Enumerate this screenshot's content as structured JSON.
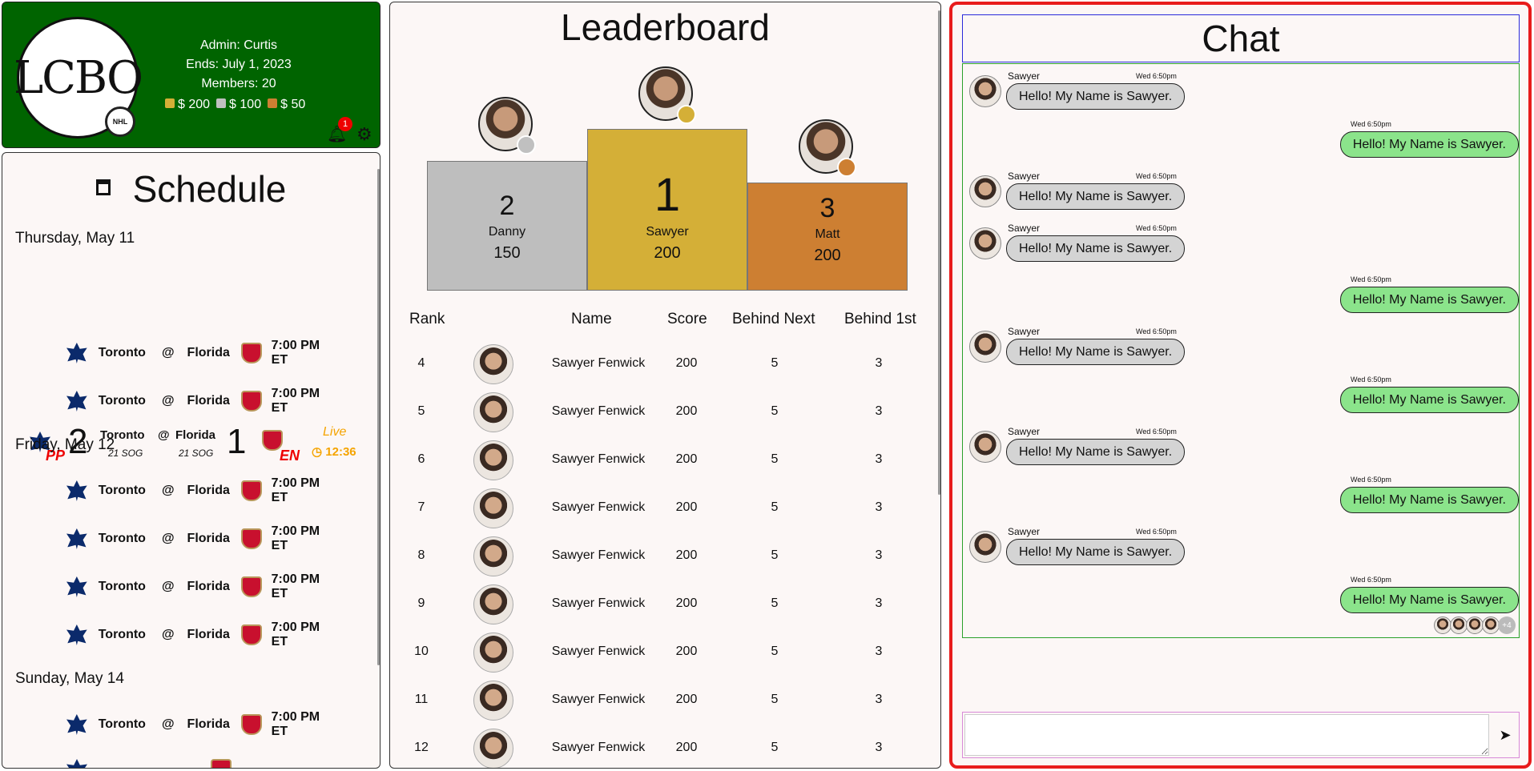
{
  "league": {
    "logo_text": "LCBO",
    "admin": "Admin: Curtis",
    "ends": "Ends: July 1, 2023",
    "members": "Members: 20",
    "prizes": [
      "$ 200",
      "$ 100",
      "$ 50"
    ],
    "notifications": "1",
    "colors": {
      "bg": "#006400",
      "gold": "#d4af37",
      "silver": "#c0c0c0",
      "bronze": "#cd7f32"
    }
  },
  "schedule": {
    "title": "Schedule",
    "days": [
      {
        "label": "Thursday, May 11"
      },
      {
        "label": "Friday, May 12"
      },
      {
        "label": "Sunday, May 14"
      }
    ],
    "live_game": {
      "home": "Toronto",
      "away": "Florida",
      "at": "@",
      "home_score": "2",
      "away_score": "1",
      "home_sog": "21 SOG",
      "away_sog": "21 SOG",
      "home_tag": "PP",
      "away_tag": "EN",
      "status": "Live",
      "clock": "12:36"
    },
    "games": [
      {
        "home": "Toronto",
        "at": "@",
        "away": "Florida",
        "time": "7:00 PM ET"
      },
      {
        "home": "Toronto",
        "at": "@",
        "away": "Florida",
        "time": "7:00 PM ET"
      },
      {
        "home": "Toronto",
        "at": "@",
        "away": "Florida",
        "time": "7:00 PM ET"
      },
      {
        "home": "Toronto",
        "at": "@",
        "away": "Florida",
        "time": "7:00 PM ET"
      },
      {
        "home": "Toronto",
        "at": "@",
        "away": "Florida",
        "time": "7:00 PM ET"
      },
      {
        "home": "Toronto",
        "at": "@",
        "away": "Florida",
        "time": "7:00 PM ET"
      },
      {
        "home": "Toronto",
        "at": "@",
        "away": "Florida",
        "time": "7:00 PM ET"
      }
    ]
  },
  "leaderboard": {
    "title": "Leaderboard",
    "podium": [
      {
        "rank": "2",
        "name": "Danny",
        "score": "150"
      },
      {
        "rank": "1",
        "name": "Sawyer",
        "score": "200"
      },
      {
        "rank": "3",
        "name": "Matt",
        "score": "200"
      }
    ],
    "headers": [
      "Rank",
      "Name",
      "Score",
      "Behind Next",
      "Behind 1st"
    ],
    "rows": [
      {
        "rank": "4",
        "name": "Sawyer Fenwick",
        "score": "200",
        "behind_next": "5",
        "behind_first": "3"
      },
      {
        "rank": "5",
        "name": "Sawyer Fenwick",
        "score": "200",
        "behind_next": "5",
        "behind_first": "3"
      },
      {
        "rank": "6",
        "name": "Sawyer Fenwick",
        "score": "200",
        "behind_next": "5",
        "behind_first": "3"
      },
      {
        "rank": "7",
        "name": "Sawyer Fenwick",
        "score": "200",
        "behind_next": "5",
        "behind_first": "3"
      },
      {
        "rank": "8",
        "name": "Sawyer Fenwick",
        "score": "200",
        "behind_next": "5",
        "behind_first": "3"
      },
      {
        "rank": "9",
        "name": "Sawyer Fenwick",
        "score": "200",
        "behind_next": "5",
        "behind_first": "3"
      },
      {
        "rank": "10",
        "name": "Sawyer Fenwick",
        "score": "200",
        "behind_next": "5",
        "behind_first": "3"
      },
      {
        "rank": "11",
        "name": "Sawyer Fenwick",
        "score": "200",
        "behind_next": "5",
        "behind_first": "3"
      },
      {
        "rank": "12",
        "name": "Sawyer Fenwick",
        "score": "200",
        "behind_next": "5",
        "behind_first": "3"
      }
    ]
  },
  "chat": {
    "title": "Chat",
    "messages": [
      {
        "from": "Sawyer",
        "time": "Wed 6:50pm",
        "text": "Hello! My Name is Sawyer.",
        "mine": false
      },
      {
        "from": "",
        "time": "Wed 6:50pm",
        "text": "Hello! My Name is Sawyer.",
        "mine": true
      },
      {
        "from": "Sawyer",
        "time": "Wed 6:50pm",
        "text": "Hello! My Name is Sawyer.",
        "mine": false
      },
      {
        "from": "Sawyer",
        "time": "Wed 6:50pm",
        "text": "Hello! My Name is Sawyer.",
        "mine": false
      },
      {
        "from": "",
        "time": "Wed 6:50pm",
        "text": "Hello! My Name is Sawyer.",
        "mine": true
      },
      {
        "from": "Sawyer",
        "time": "Wed 6:50pm",
        "text": "Hello! My Name is Sawyer.",
        "mine": false
      },
      {
        "from": "",
        "time": "Wed 6:50pm",
        "text": "Hello! My Name is Sawyer.",
        "mine": true
      },
      {
        "from": "Sawyer",
        "time": "Wed 6:50pm",
        "text": "Hello! My Name is Sawyer.",
        "mine": false
      },
      {
        "from": "",
        "time": "Wed 6:50pm",
        "text": "Hello! My Name is Sawyer.",
        "mine": true
      },
      {
        "from": "Sawyer",
        "time": "Wed 6:50pm",
        "text": "Hello! My Name is Sawyer.",
        "mine": false
      },
      {
        "from": "",
        "time": "Wed 6:50pm",
        "text": "Hello! My Name is Sawyer.",
        "mine": true
      }
    ],
    "readers_more": "+4",
    "input_value": "",
    "send_icon": "send-icon"
  }
}
